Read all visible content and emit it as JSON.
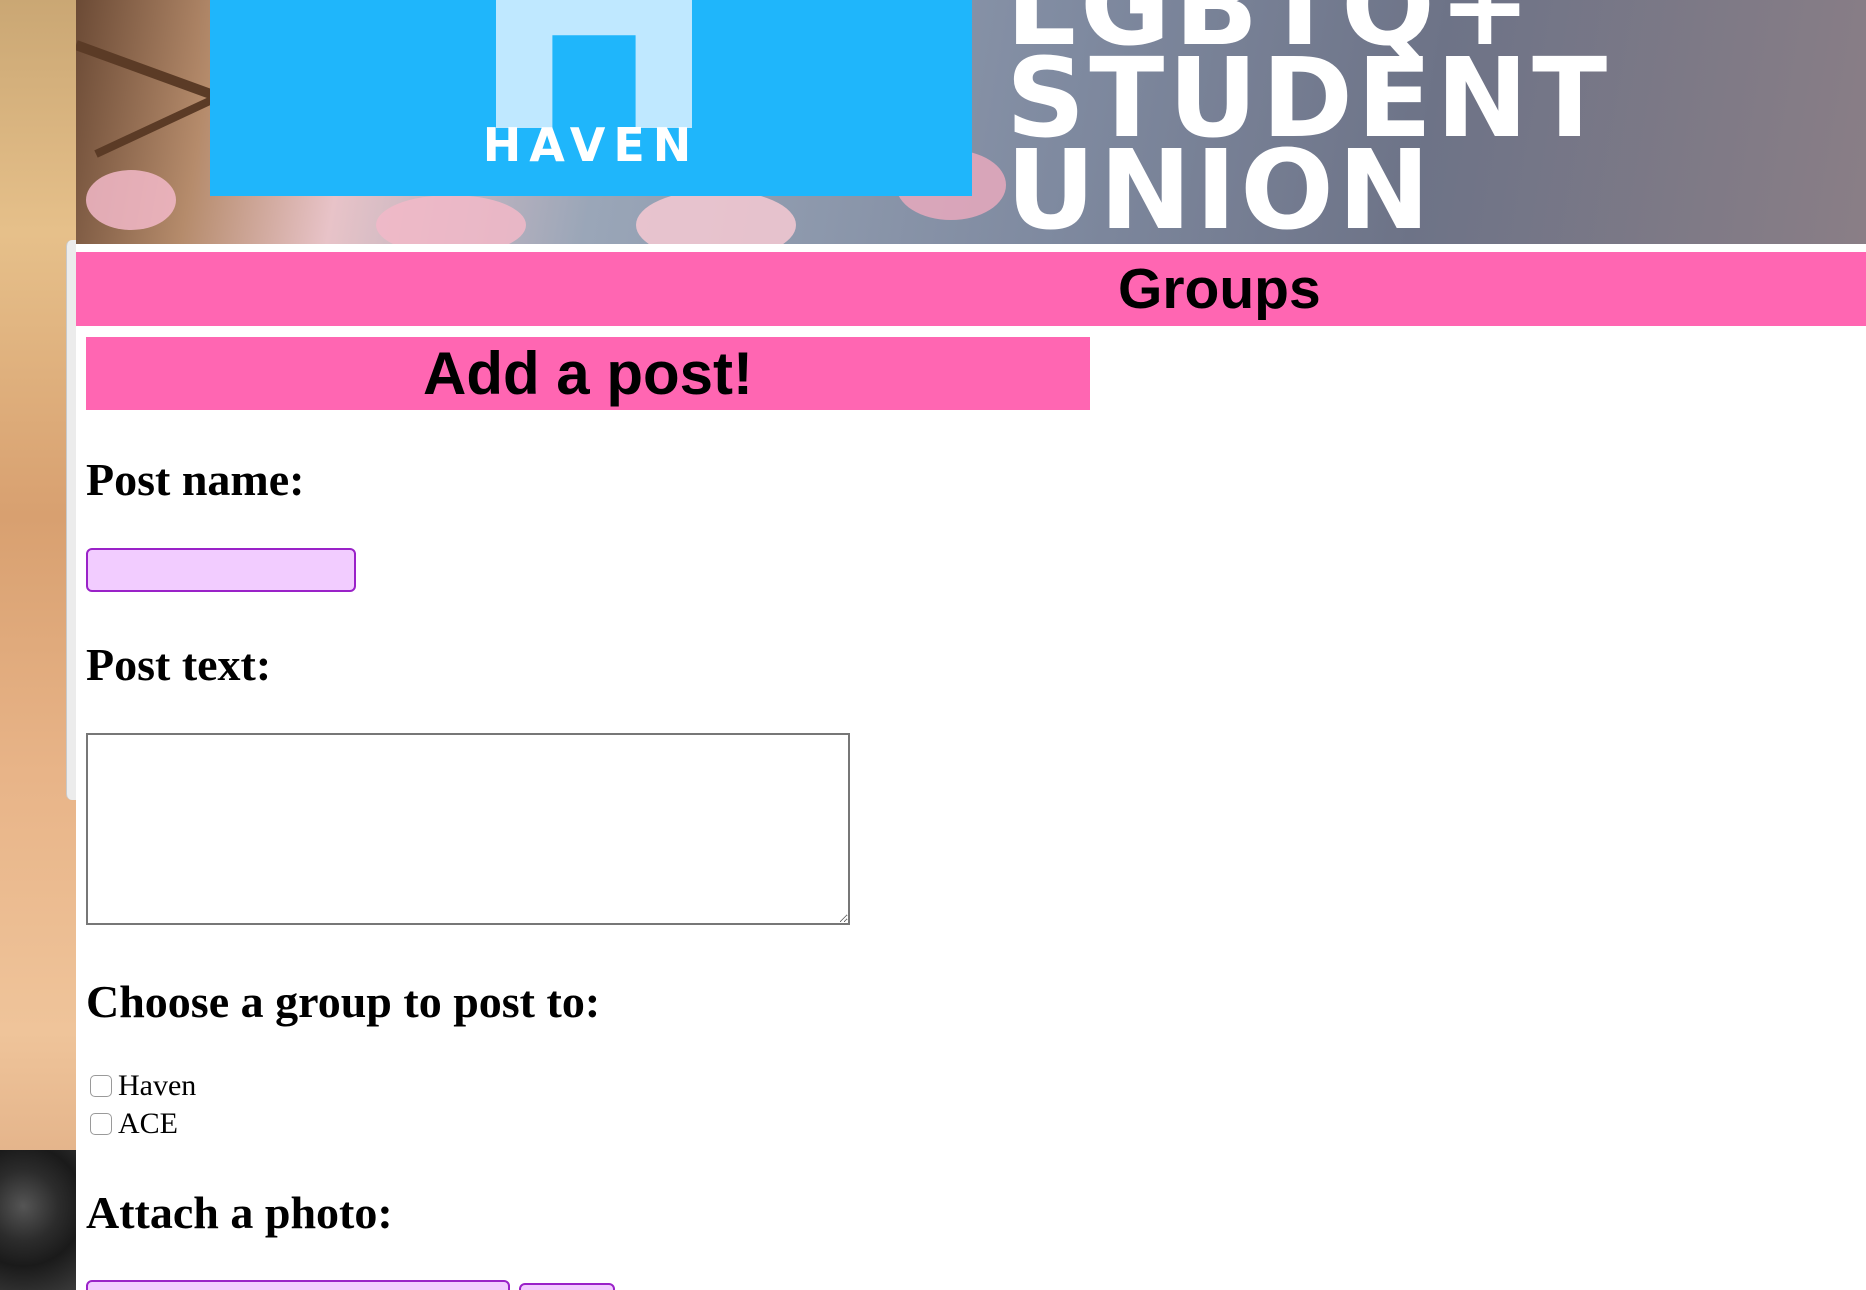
{
  "banner": {
    "logo_word": "HAVEN",
    "logo_letter": "H",
    "title_lines": "LGBTQ+\nSTUDENT\nUNION"
  },
  "header": {
    "section_title": "Groups"
  },
  "form": {
    "title": "Add a post!",
    "post_name_label": "Post name:",
    "post_name_value": "",
    "post_text_label": "Post text:",
    "post_text_value": "",
    "group_label": "Choose a group to post to:",
    "groups": [
      {
        "label": "Haven",
        "checked": false
      },
      {
        "label": "ACE",
        "checked": false
      }
    ],
    "photo_label": "Attach a photo:"
  },
  "colors": {
    "accent_pink": "#ff66b2",
    "input_bg": "#f2ccff",
    "input_border": "#9a22c8",
    "logo_blue": "#1fb6fb"
  }
}
